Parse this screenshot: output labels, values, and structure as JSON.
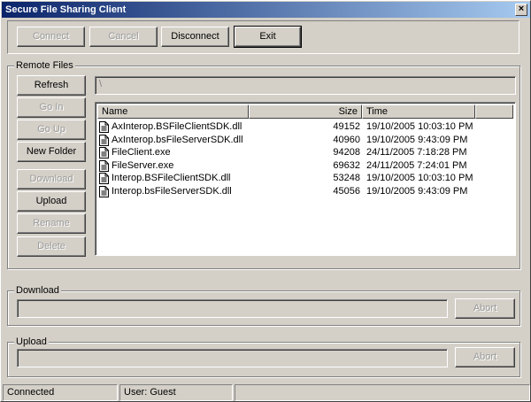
{
  "window": {
    "title": "Secure File Sharing Client",
    "close_label": "x"
  },
  "toolbar": {
    "connect_label": "Connect",
    "cancel_label": "Cancel",
    "disconnect_label": "Disconnect",
    "exit_label": "Exit"
  },
  "remote": {
    "group_label": "Remote Files",
    "path": "\\",
    "buttons": {
      "refresh": "Refresh",
      "go_in": "Go In",
      "go_up": "Go Up",
      "new_folder": "New Folder",
      "download": "Download",
      "upload": "Upload",
      "rename": "Rename",
      "delete": "Delete"
    },
    "columns": {
      "name": "Name",
      "size": "Size",
      "time": "Time"
    },
    "files": [
      {
        "name": "AxInterop.BSFileClientSDK.dll",
        "size": "49152",
        "time": "19/10/2005 10:03:10 PM"
      },
      {
        "name": "AxInterop.bsFileServerSDK.dll",
        "size": "40960",
        "time": "19/10/2005 9:43:09 PM"
      },
      {
        "name": "FileClient.exe",
        "size": "94208",
        "time": "24/11/2005 7:18:28 PM"
      },
      {
        "name": "FileServer.exe",
        "size": "69632",
        "time": "24/11/2005 7:24:01 PM"
      },
      {
        "name": "Interop.BSFileClientSDK.dll",
        "size": "53248",
        "time": "19/10/2005 10:03:10 PM"
      },
      {
        "name": "Interop.bsFileServerSDK.dll",
        "size": "45056",
        "time": "19/10/2005 9:43:09 PM"
      }
    ]
  },
  "download": {
    "group_label": "Download",
    "abort_label": "Abort",
    "progress": 0
  },
  "upload": {
    "group_label": "Upload",
    "abort_label": "Abort",
    "progress": 0
  },
  "status": {
    "connection": "Connected",
    "user": "User: Guest",
    "extra": ""
  }
}
